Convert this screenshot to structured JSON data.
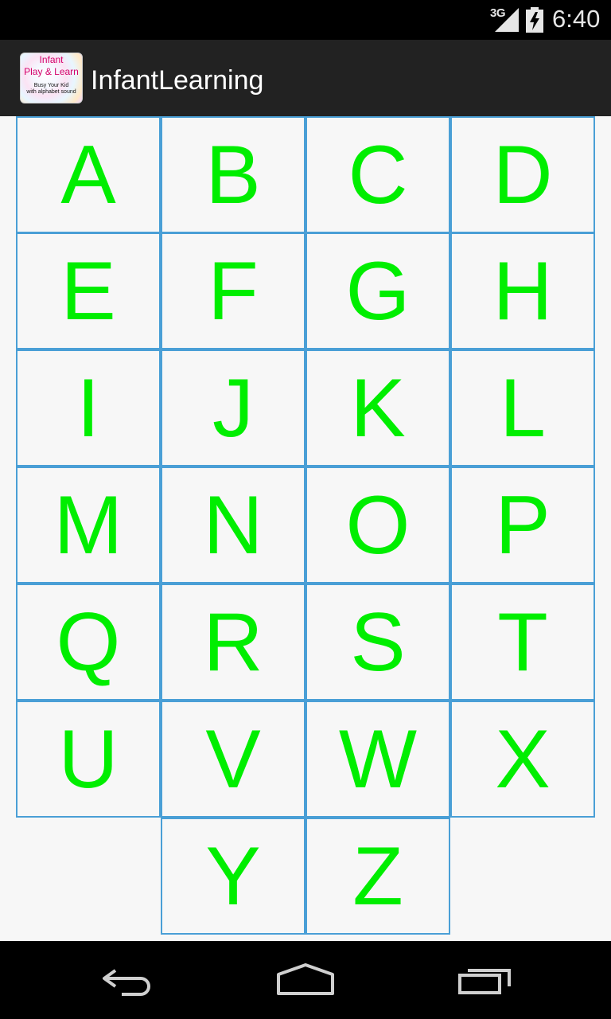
{
  "status_bar": {
    "network": "3G",
    "time": "6:40"
  },
  "action_bar": {
    "title": "InfantLearning",
    "icon_text": {
      "line1": "Infant",
      "line2": "Play & Learn",
      "line3": "Busy Your Kid",
      "line4": "with alphabet sound"
    }
  },
  "letters": [
    "A",
    "B",
    "C",
    "D",
    "E",
    "F",
    "G",
    "H",
    "I",
    "J",
    "K",
    "L",
    "M",
    "N",
    "O",
    "P",
    "Q",
    "R",
    "S",
    "T",
    "U",
    "V",
    "W",
    "X",
    "Y",
    "Z"
  ],
  "colors": {
    "letter": "#00ee00",
    "tile_border": "#4a9fd6",
    "background": "#f7f7f7",
    "action_bar": "#222222"
  },
  "nav_bar": {
    "icons": [
      "back-icon",
      "home-icon",
      "recent-apps-icon"
    ]
  }
}
